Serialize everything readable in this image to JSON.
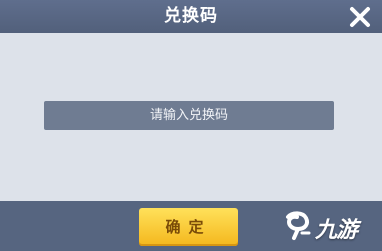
{
  "dialog": {
    "title": "兑换码",
    "close_icon": "close-icon"
  },
  "code_input": {
    "placeholder": "请输入兑换码",
    "value": ""
  },
  "confirm_button": {
    "label": "确定"
  },
  "watermark": {
    "text": "九游",
    "icon": "nine-game-logo"
  },
  "colors": {
    "dialog_background": "#dde2ea",
    "input_background": "#6f7c92",
    "button_background": "#f7c637"
  }
}
